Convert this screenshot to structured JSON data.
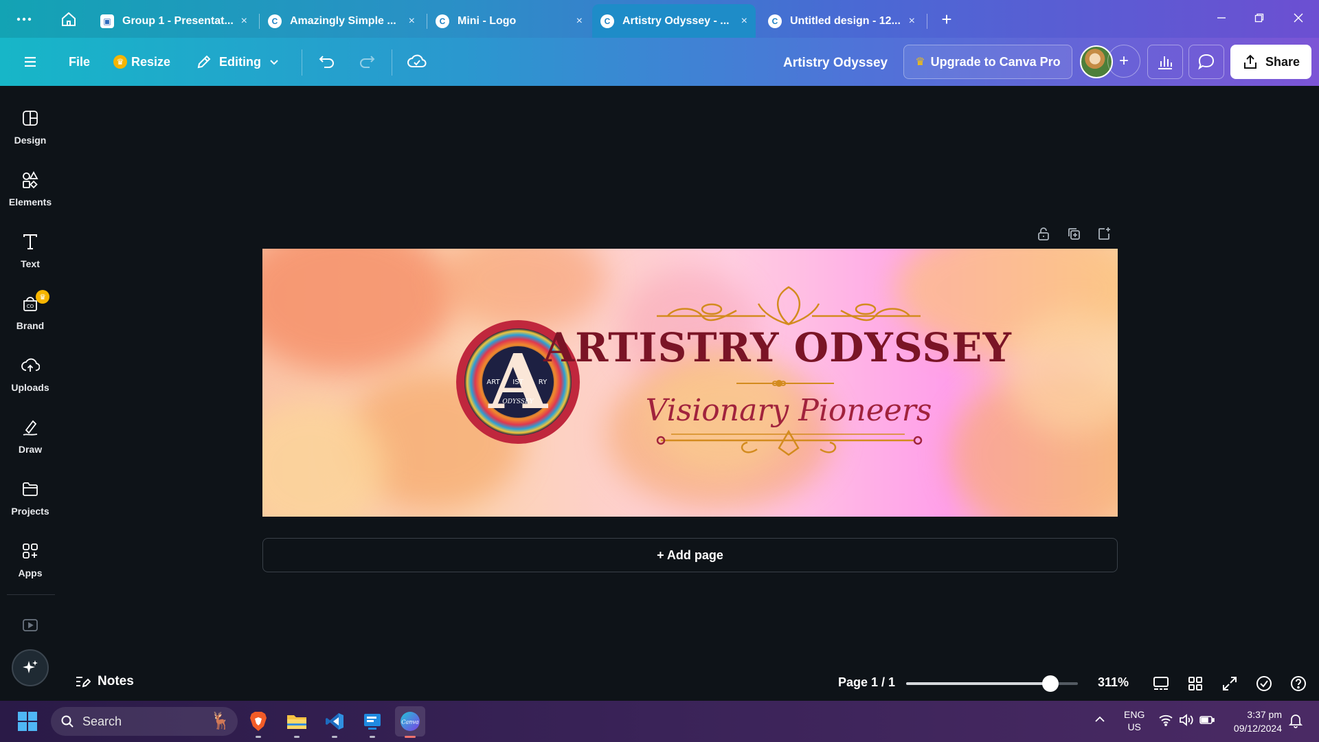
{
  "browser": {
    "tabs": [
      {
        "title": "Group 1 - Presentat...",
        "fav": "group"
      },
      {
        "title": "Amazingly Simple ...",
        "fav": "C"
      },
      {
        "title": "Mini - Logo",
        "fav": "C"
      },
      {
        "title": "Artistry Odyssey - ...",
        "fav": "C"
      },
      {
        "title": "Untitled design - 12...",
        "fav": "C"
      }
    ],
    "new_tab": "+",
    "close": "×"
  },
  "toolbar": {
    "file": "File",
    "resize": "Resize",
    "editing": "Editing",
    "doc_title": "Artistry Odyssey",
    "upgrade": "Upgrade to Canva Pro",
    "add_collaborator": "+",
    "share": "Share"
  },
  "sidebar": {
    "items": [
      {
        "label": "Design"
      },
      {
        "label": "Elements"
      },
      {
        "label": "Text"
      },
      {
        "label": "Brand"
      },
      {
        "label": "Uploads"
      },
      {
        "label": "Draw"
      },
      {
        "label": "Projects"
      },
      {
        "label": "Apps"
      }
    ]
  },
  "design": {
    "title": "ARTISTRY ODYSSEY",
    "subtitle": "Visionary Pioneers",
    "logo_letter": "A",
    "logo_left": "ART",
    "logo_mid": "IST",
    "logo_right": "RY",
    "logo_bottom": "ODYSSEY"
  },
  "canvas": {
    "add_page": "+ Add page"
  },
  "footer": {
    "notes": "Notes",
    "page_indicator": "Page 1 / 1",
    "zoom": "311%",
    "zoom_fraction": 0.84
  },
  "taskbar": {
    "search_placeholder": "Search",
    "lang_top": "ENG",
    "lang_bottom": "US",
    "time": "3:37 pm",
    "date": "09/12/2024"
  },
  "colors": {
    "accent_cyan": "#17b6c8",
    "accent_purple": "#7c55d6",
    "title_red": "#7a1426",
    "subtitle_red": "#a1233d",
    "gold": "#d38b1e"
  }
}
